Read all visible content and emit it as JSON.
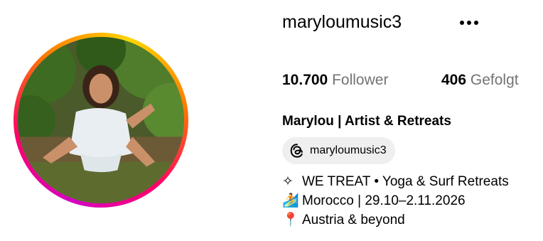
{
  "profile": {
    "username": "maryloumusic3",
    "followers_count": "10.700",
    "followers_label": "Follower",
    "following_count": "406",
    "following_label": "Gefolgt",
    "display_name": "Marylou | Artist & Retreats",
    "threads_handle": "maryloumusic3",
    "bio": [
      {
        "icon": "sparkle-icon",
        "symbol": "✧",
        "text": "WE TREAT • Yoga & Surf Retreats"
      },
      {
        "icon": "surfer-icon",
        "symbol": "🏄",
        "text": "Morocco | 29.10–2.11.2026"
      },
      {
        "icon": "pin-icon",
        "symbol": "📍",
        "text": "Austria & beyond"
      }
    ]
  },
  "colors": {
    "ring_gradient": [
      "#d300c5",
      "#ff0069",
      "#ff7a00",
      "#ffd600"
    ],
    "muted_text": "#737373",
    "pill_bg": "#efefef"
  }
}
